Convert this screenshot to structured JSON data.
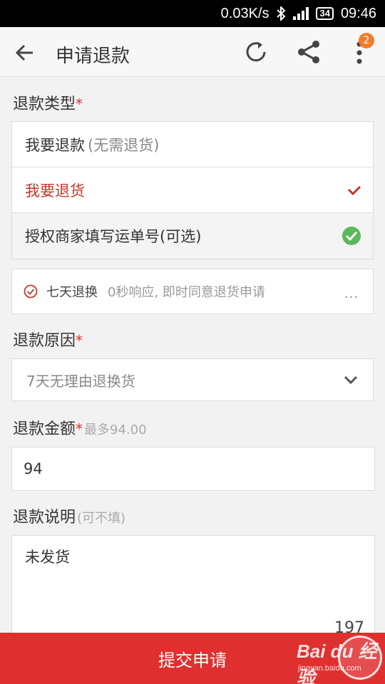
{
  "status_bar": {
    "speed": "0.03K/s",
    "battery": "34",
    "time": "09:46"
  },
  "header": {
    "title": "申请退款",
    "notification_count": "2"
  },
  "refund_type": {
    "label": "退款类型",
    "options": [
      {
        "label": "我要退款",
        "note": "(无需退货)"
      },
      {
        "label": "我要退货"
      },
      {
        "label": "授权商家填写运单号(可选)"
      }
    ]
  },
  "service_promise": {
    "name": "七天退换",
    "desc": "0秒响应, 即时同意退货申请",
    "more": "..."
  },
  "reason": {
    "label": "退款原因",
    "selected": "7天无理由退换货"
  },
  "amount": {
    "label": "退款金额",
    "hint": "最多94.00",
    "value": "94"
  },
  "explanation": {
    "label": "退款说明",
    "hint": "(可不填)",
    "value": "未发货",
    "counter": "197"
  },
  "submit_label": "提交申请",
  "watermark": {
    "logo": "Bai du 经验",
    "url": "jingyan.baidu.com"
  },
  "colors": {
    "accent": "#e02f2f",
    "selected_text": "#c0392b",
    "check_green": "#5cb85c",
    "badge": "#f37b2a"
  }
}
